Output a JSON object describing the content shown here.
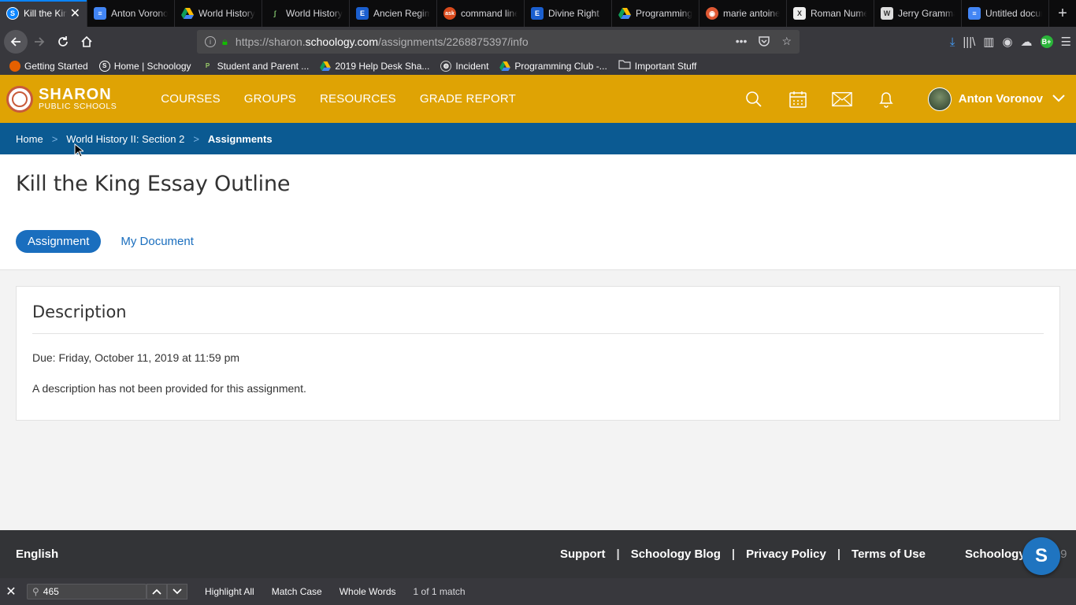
{
  "browser": {
    "tabs": [
      {
        "title": "Kill the King Essay Outline",
        "icon": "schoology-icon",
        "color": "#0a84ff",
        "active": true
      },
      {
        "title": "Anton Voronov",
        "icon": "docs-icon",
        "color": "#4285f4"
      },
      {
        "title": "World History",
        "icon": "drive-icon",
        "color": "#0f9d58"
      },
      {
        "title": "World History",
        "icon": "feather-icon",
        "color": "#4a7a3a"
      },
      {
        "title": "Ancien Regime",
        "icon": "edpuzzle-icon",
        "color": "#1b5fcf"
      },
      {
        "title": "command line",
        "icon": "ask-icon",
        "color": "#d94a1c"
      },
      {
        "title": "Divine Right",
        "icon": "edpuzzle-icon",
        "color": "#1b5fcf"
      },
      {
        "title": "Programming",
        "icon": "drive-icon",
        "color": "#0f9d58"
      },
      {
        "title": "marie antoinette",
        "icon": "duckduckgo-icon",
        "color": "#de5833"
      },
      {
        "title": "Roman Numerals",
        "icon": "x-icon",
        "color": "#555555"
      },
      {
        "title": "Jerry Grammar",
        "icon": "wikipedia-icon",
        "color": "#777777"
      },
      {
        "title": "Untitled document",
        "icon": "docs-icon",
        "color": "#4285f4"
      }
    ],
    "url": {
      "prefix": "https://sharon.",
      "host": "schoology.com",
      "path": "/assignments/2268875397/info"
    },
    "bookmarks": [
      {
        "label": "Getting Started",
        "icon": "firefox-icon",
        "color": "#e66000"
      },
      {
        "label": "Home | Schoology",
        "icon": "schoology-icon",
        "color": "#1f74c0"
      },
      {
        "label": "Student and Parent ...",
        "icon": "powerschool-icon",
        "color": "#2d6c3f"
      },
      {
        "label": "2019 Help Desk Sha...",
        "icon": "drive-icon",
        "color": "#0f9d58"
      },
      {
        "label": "Incident",
        "icon": "globe-icon",
        "color": "#777777"
      },
      {
        "label": "Programming Club -...",
        "icon": "drive-icon",
        "color": "#0f9d58"
      },
      {
        "label": "Important Stuff",
        "icon": "folder-icon",
        "color": "#b0b0b0"
      }
    ]
  },
  "header": {
    "logo_line1": "SHARON",
    "logo_line2": "PUBLIC SCHOOLS",
    "nav": [
      "COURSES",
      "GROUPS",
      "RESOURCES",
      "GRADE REPORT"
    ],
    "user_name": "Anton Voronov",
    "accent": "#dfa304"
  },
  "breadcrumb": {
    "home": "Home",
    "sep": ">",
    "course": "World History II: Section 2",
    "current": "Assignments"
  },
  "page": {
    "title": "Kill the King Essay Outline",
    "tab_active": "Assignment",
    "tab_other": "My Document"
  },
  "description": {
    "heading": "Description",
    "due": "Due: Friday, October 11, 2019 at 11:59 pm",
    "text": "A description has not been provided for this assignment."
  },
  "footer": {
    "language": "English",
    "links": [
      "Support",
      "Schoology Blog",
      "Privacy Policy",
      "Terms of Use"
    ],
    "pipe": "|",
    "brand": "Schoology",
    "copyright": "© 2019",
    "bubble": "S"
  },
  "findbar": {
    "query": "465",
    "highlight_all": "Highlight All",
    "match_case": "Match Case",
    "whole_words": "Whole Words",
    "status": "1 of 1 match"
  }
}
